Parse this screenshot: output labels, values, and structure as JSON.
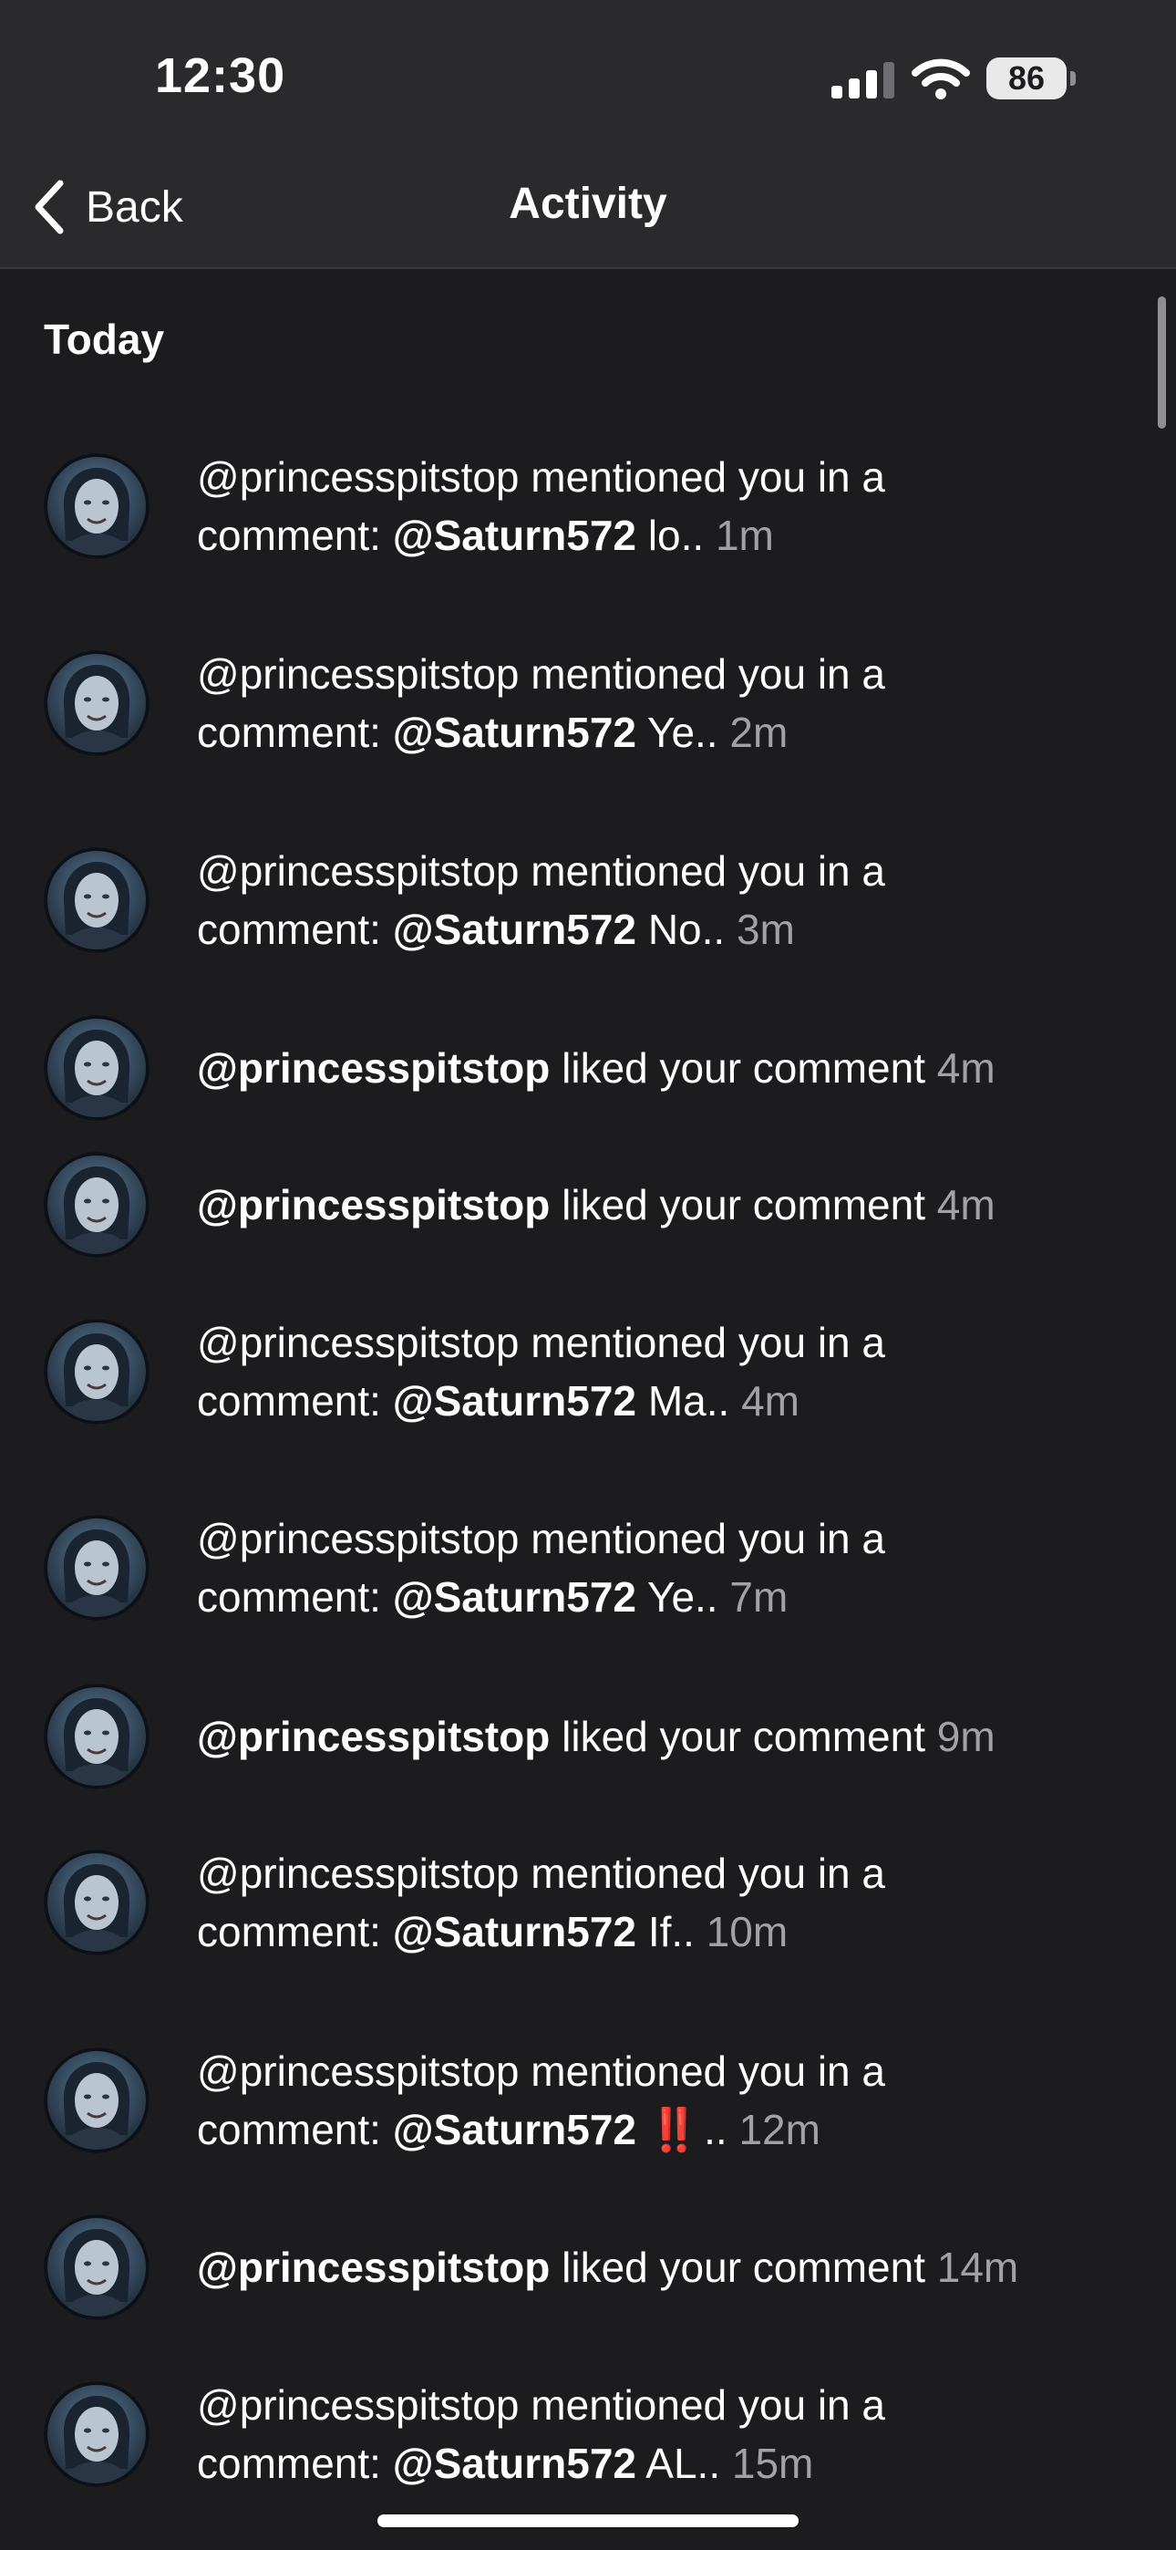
{
  "status_bar": {
    "time": "12:30",
    "battery": "86"
  },
  "nav": {
    "back_label": "Back",
    "title": "Activity"
  },
  "section": {
    "label": "Today"
  },
  "items": [
    {
      "type": "mention",
      "user": "@princesspitstop",
      "action": "mentioned you in a",
      "prefix": "comment:",
      "target": "@Saturn572",
      "snippet": "lo..",
      "time": "1m"
    },
    {
      "type": "mention",
      "user": "@princesspitstop",
      "action": "mentioned you in a",
      "prefix": "comment:",
      "target": "@Saturn572",
      "snippet": "Ye..",
      "time": "2m"
    },
    {
      "type": "mention",
      "user": "@princesspitstop",
      "action": "mentioned you in a",
      "prefix": "comment:",
      "target": "@Saturn572",
      "snippet": "No..",
      "time": "3m"
    },
    {
      "type": "like",
      "user": "@princesspitstop",
      "action": "liked your comment",
      "time": "4m"
    },
    {
      "type": "like",
      "user": "@princesspitstop",
      "action": "liked your comment",
      "time": "4m"
    },
    {
      "type": "mention",
      "user": "@princesspitstop",
      "action": "mentioned you in a",
      "prefix": "comment:",
      "target": "@Saturn572",
      "snippet": "Ma..",
      "time": "4m"
    },
    {
      "type": "mention",
      "user": "@princesspitstop",
      "action": "mentioned you in a",
      "prefix": "comment:",
      "target": "@Saturn572",
      "snippet": "Ye..",
      "time": "7m"
    },
    {
      "type": "like",
      "user": "@princesspitstop",
      "action": "liked your comment",
      "time": "9m"
    },
    {
      "type": "mention",
      "user": "@princesspitstop",
      "action": "mentioned you in a",
      "prefix": "comment:",
      "target": "@Saturn572",
      "snippet": "If..",
      "time": "10m"
    },
    {
      "type": "mention",
      "user": "@princesspitstop",
      "action": "mentioned you in a",
      "prefix": "comment:",
      "target": "@Saturn572",
      "emoji": "‼️",
      "snippet": "..",
      "time": "12m"
    },
    {
      "type": "like",
      "user": "@princesspitstop",
      "action": "liked your comment",
      "time": "14m"
    },
    {
      "type": "mention",
      "user": "@princesspitstop",
      "action": "mentioned you in a",
      "prefix": "comment:",
      "target": "@Saturn572",
      "snippet": "AL..",
      "time": "15m"
    }
  ]
}
